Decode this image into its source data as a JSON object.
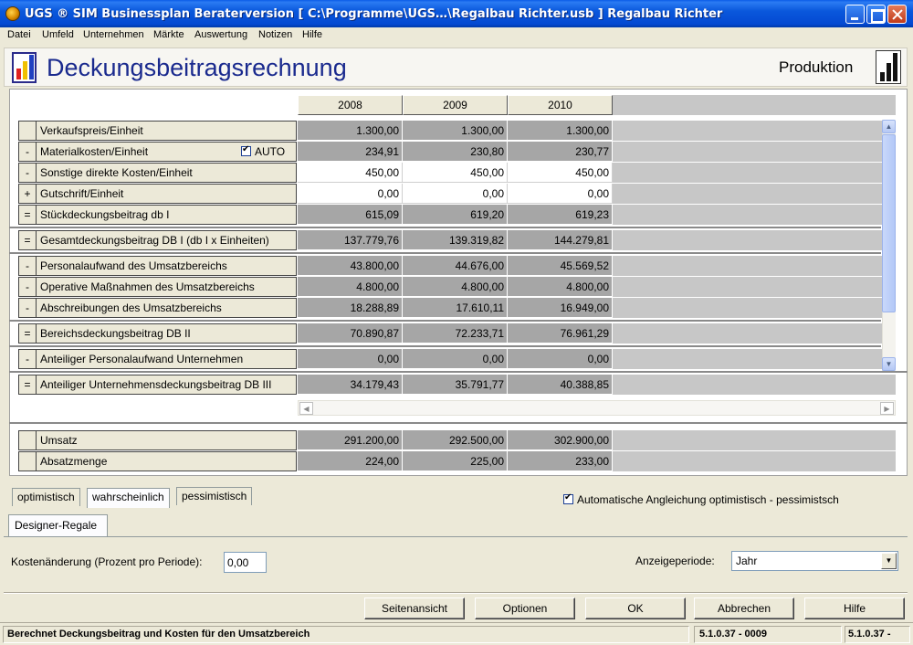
{
  "window": {
    "title": "UGS ® SIM Businessplan Beraterversion   [ C:\\Programme\\UGS…\\Regalbau Richter.usb ] Regalbau Richter"
  },
  "menu": [
    "Datei",
    "Umfeld",
    "Unternehmen",
    "Märkte",
    "Auswertung",
    "Notizen",
    "Hilfe"
  ],
  "header": {
    "title": "Deckungsbeitragsrechnung",
    "section": "Produktion"
  },
  "years": [
    "2008",
    "2009",
    "2010"
  ],
  "auto_label": "AUTO",
  "rows": [
    {
      "sign": "",
      "label": "Verkaufspreis/Einheit",
      "values": [
        "1.300,00",
        "1.300,00",
        "1.300,00"
      ],
      "editable": false
    },
    {
      "sign": "-",
      "label": "Materialkosten/Einheit",
      "values": [
        "234,91",
        "230,80",
        "230,77"
      ],
      "editable": false
    },
    {
      "sign": "-",
      "label": "Sonstige direkte Kosten/Einheit",
      "values": [
        "450,00",
        "450,00",
        "450,00"
      ],
      "editable": true
    },
    {
      "sign": "+",
      "label": "Gutschrift/Einheit",
      "values": [
        "0,00",
        "0,00",
        "0,00"
      ],
      "editable": true
    },
    {
      "sign": "=",
      "label": "Stückdeckungsbeitrag db I",
      "values": [
        "615,09",
        "619,20",
        "619,23"
      ],
      "editable": false
    },
    {
      "sign": "=",
      "label": "Gesamtdeckungsbeitrag DB I (db I x Einheiten)",
      "values": [
        "137.779,76",
        "139.319,82",
        "144.279,81"
      ],
      "editable": false
    },
    {
      "sign": "-",
      "label": "Personalaufwand des Umsatzbereichs",
      "values": [
        "43.800,00",
        "44.676,00",
        "45.569,52"
      ],
      "editable": false
    },
    {
      "sign": "-",
      "label": "Operative Maßnahmen des Umsatzbereichs",
      "values": [
        "4.800,00",
        "4.800,00",
        "4.800,00"
      ],
      "editable": false
    },
    {
      "sign": "-",
      "label": "Abschreibungen des Umsatzbereichs",
      "values": [
        "18.288,89",
        "17.610,11",
        "16.949,00"
      ],
      "editable": false
    },
    {
      "sign": "=",
      "label": "Bereichsdeckungsbeitrag DB II",
      "values": [
        "70.890,87",
        "72.233,71",
        "76.961,29"
      ],
      "editable": false
    },
    {
      "sign": "-",
      "label": "Anteiliger Personalaufwand Unternehmen",
      "values": [
        "0,00",
        "0,00",
        "0,00"
      ],
      "editable": false
    },
    {
      "sign": "=",
      "label": "Anteiliger Unternehmensdeckungsbeitrag DB III",
      "values": [
        "34.179,43",
        "35.791,77",
        "40.388,85"
      ],
      "editable": false
    }
  ],
  "summary_rows": [
    {
      "sign": "",
      "label": "Umsatz",
      "values": [
        "291.200,00",
        "292.500,00",
        "302.900,00"
      ]
    },
    {
      "sign": "",
      "label": "Absatzmenge",
      "values": [
        "224,00",
        "225,00",
        "233,00"
      ]
    }
  ],
  "scenario_tabs": [
    "optimistisch",
    "wahrscheinlich",
    "pessimistisch"
  ],
  "auto_adjust_label": "Automatische Angleichung optimistisch - pessimistsch",
  "product_tab": "Designer-Regale",
  "kosten": {
    "label": "Kostenänderung (Prozent pro Periode):",
    "value": "0,00"
  },
  "period": {
    "label": "Anzeigeperiode:",
    "value": "Jahr"
  },
  "buttons": {
    "seitenansicht": "Seitenansicht",
    "optionen": "Optionen",
    "ok": "OK",
    "abbrechen": "Abbrechen",
    "hilfe": "Hilfe"
  },
  "status": {
    "message": "Berechnet Deckungsbeitrag und Kosten für den Umsatzbereich",
    "version1": "5.1.0.37 - 0009",
    "version2": "5.1.0.37 -"
  }
}
